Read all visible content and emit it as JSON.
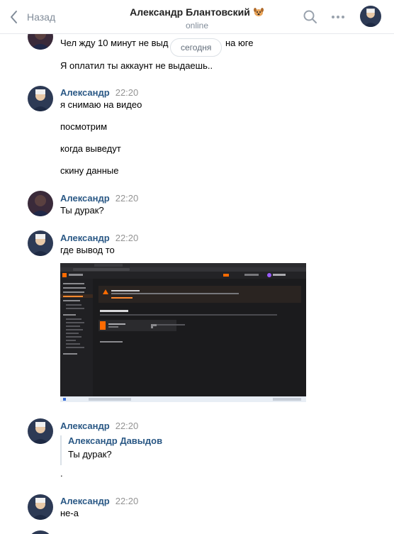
{
  "header": {
    "back_label": "Назад",
    "title": "Александр Блантовский",
    "status": "online"
  },
  "date_separator": "сегодня",
  "messages": [
    {
      "author": "",
      "time": "",
      "lines": [
        "Чел жду 10 минут не выд",
        "на юге",
        "Я оплатил ты аккаунт не выдаешь.."
      ]
    },
    {
      "author": "Александр",
      "time": "22:20",
      "lines": [
        "я снимаю на видео",
        "посмотрим",
        "когда выведут",
        "скину данные"
      ]
    },
    {
      "author": "Александр",
      "time": "22:20",
      "lines": [
        "Ты дурак?"
      ]
    },
    {
      "author": "Александр",
      "time": "22:20",
      "lines": [
        "где вывод то"
      ]
    },
    {
      "author": "Александр",
      "time": "22:20",
      "lines": [
        "."
      ],
      "quote": {
        "author": "Александр Давыдов",
        "text": "Ты дурак?"
      }
    },
    {
      "author": "Александр",
      "time": "22:20",
      "lines": [
        "не-а"
      ]
    }
  ],
  "colors": {
    "link": "#2a5885",
    "muted": "#818c99",
    "accent_orange": "#ff6b00"
  },
  "icons": [
    "chevron-left-icon",
    "dog-emoji-icon",
    "search-icon",
    "more-icon"
  ]
}
